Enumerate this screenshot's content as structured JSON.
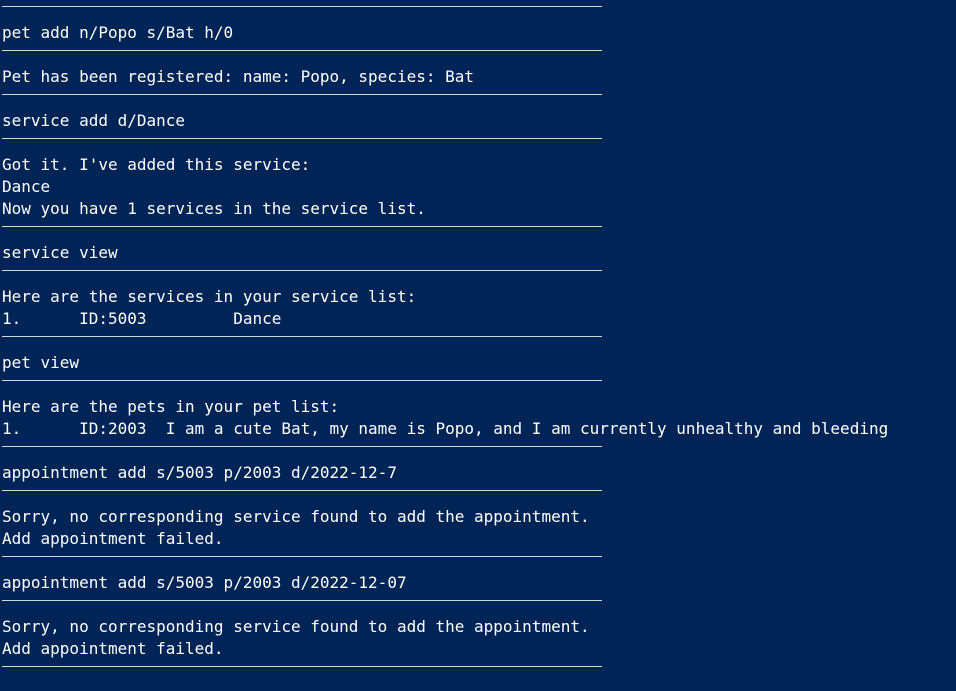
{
  "terminal": {
    "lines": [
      {
        "type": "sep"
      },
      {
        "type": "text",
        "text": "pet add n/Popo s/Bat h/0"
      },
      {
        "type": "sep"
      },
      {
        "type": "text",
        "text": "Pet has been registered: name: Popo, species: Bat"
      },
      {
        "type": "sep"
      },
      {
        "type": "text",
        "text": "service add d/Dance"
      },
      {
        "type": "sep"
      },
      {
        "type": "text",
        "text": "Got it. I've added this service:"
      },
      {
        "type": "text",
        "text": "Dance"
      },
      {
        "type": "text",
        "text": "Now you have 1 services in the service list."
      },
      {
        "type": "sep"
      },
      {
        "type": "text",
        "text": "service view"
      },
      {
        "type": "sep"
      },
      {
        "type": "text",
        "text": "Here are the services in your service list:"
      },
      {
        "type": "text",
        "text": "1.      ID:5003         Dance"
      },
      {
        "type": "sep"
      },
      {
        "type": "text",
        "text": "pet view"
      },
      {
        "type": "sep"
      },
      {
        "type": "text",
        "text": "Here are the pets in your pet list:"
      },
      {
        "type": "text",
        "text": "1.      ID:2003  I am a cute Bat, my name is Popo, and I am currently unhealthy and bleeding"
      },
      {
        "type": "sep"
      },
      {
        "type": "text",
        "text": "appointment add s/5003 p/2003 d/2022-12-7"
      },
      {
        "type": "sep"
      },
      {
        "type": "text",
        "text": "Sorry, no corresponding service found to add the appointment."
      },
      {
        "type": "text",
        "text": "Add appointment failed."
      },
      {
        "type": "sep"
      },
      {
        "type": "text",
        "text": "appointment add s/5003 p/2003 d/2022-12-07"
      },
      {
        "type": "sep"
      },
      {
        "type": "text",
        "text": "Sorry, no corresponding service found to add the appointment."
      },
      {
        "type": "text",
        "text": "Add appointment failed."
      },
      {
        "type": "sep"
      }
    ],
    "colors": {
      "background": "#012456",
      "foreground": "#ffffff",
      "separator": "#cfd6e2"
    }
  }
}
